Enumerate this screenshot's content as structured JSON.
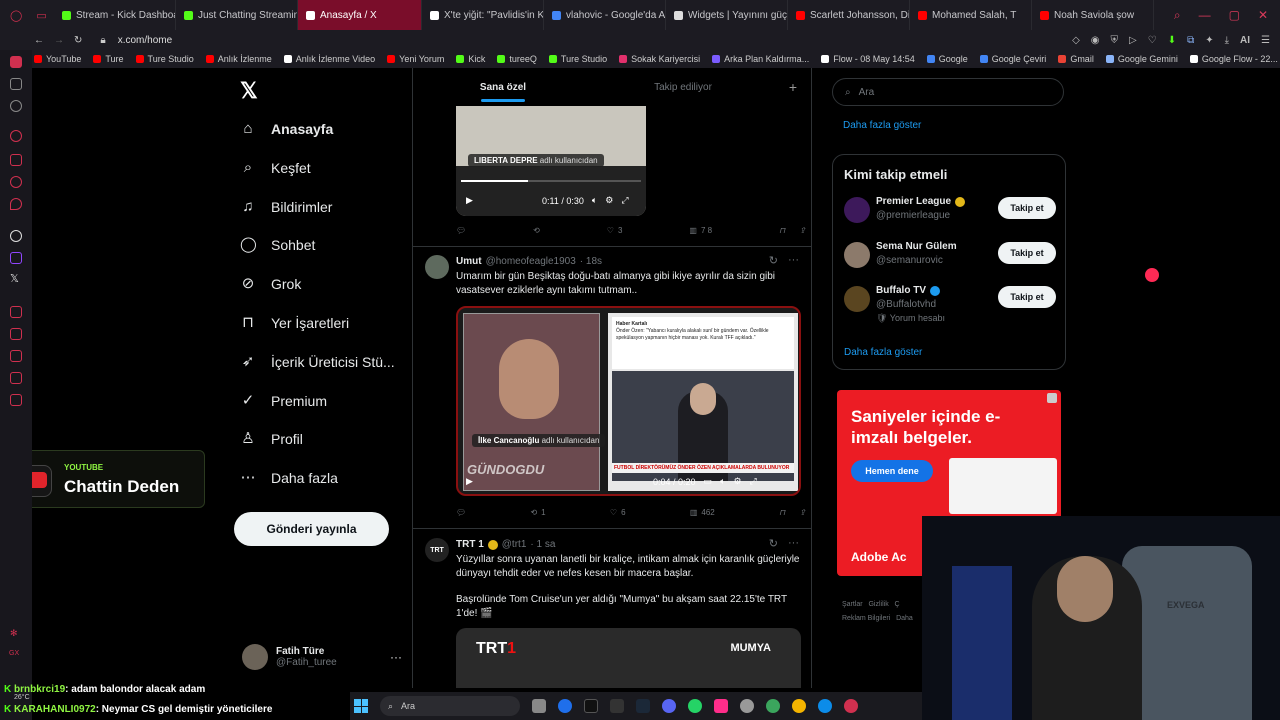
{
  "browser": {
    "tabs": [
      {
        "title": "Stream - Kick Dashboard",
        "color": "#53fc18",
        "active": false
      },
      {
        "title": "Just Chatting Streaming",
        "color": "#53fc18",
        "active": false
      },
      {
        "title": "Anasayfa / X",
        "color": "#ffffff",
        "active": true
      },
      {
        "title": "X'te yiğit: \"Pavlidis'in Ker",
        "color": "#ffffff",
        "active": false
      },
      {
        "title": "vlahovic - Google'da Ara",
        "color": "#4285f4",
        "active": false
      },
      {
        "title": "Widgets | Yayınını güçlen",
        "color": "#dddddd",
        "active": false
      },
      {
        "title": "Scarlett Johansson, Disn",
        "color": "#ff0000",
        "active": false
      },
      {
        "title": "Mohamed Salah, T",
        "color": "#ff0000",
        "active": false
      },
      {
        "title": "Noah Saviola şow",
        "color": "#ff0000",
        "active": false
      }
    ],
    "url": "x.com/home",
    "ai_label": "AI",
    "bookmarks": [
      {
        "label": "YouTube",
        "color": "#ff0000"
      },
      {
        "label": "Ture",
        "color": "#ff0000"
      },
      {
        "label": "Ture Studio",
        "color": "#ff0000"
      },
      {
        "label": "Anlık İzlenme",
        "color": "#ff0000"
      },
      {
        "label": "Anlık İzlenme Video",
        "color": "#ffffff"
      },
      {
        "label": "Yeni Yorum",
        "color": "#ff0000"
      },
      {
        "label": "Kick",
        "color": "#53fc18"
      },
      {
        "label": "tureeQ",
        "color": "#53fc18"
      },
      {
        "label": "Ture Studio",
        "color": "#53fc18"
      },
      {
        "label": "Sokak Kariyercisi",
        "color": "#e1306c"
      },
      {
        "label": "Arka Plan Kaldırma...",
        "color": "#7b5cff"
      },
      {
        "label": "Flow - 08 May 14:54",
        "color": "#ffffff"
      },
      {
        "label": "Google",
        "color": "#4285f4"
      },
      {
        "label": "Google Çeviri",
        "color": "#4285f4"
      },
      {
        "label": "Gmail",
        "color": "#ea4335"
      },
      {
        "label": "Google Gemini",
        "color": "#8ab4f8"
      },
      {
        "label": "Google Flow - 22...",
        "color": "#ffffff"
      }
    ]
  },
  "nav": {
    "logo": "𝕏",
    "items": [
      {
        "label": "Anasayfa",
        "icon": "⌂"
      },
      {
        "label": "Keşfet",
        "icon": "⌕"
      },
      {
        "label": "Bildirimler",
        "icon": "♫"
      },
      {
        "label": "Sohbet",
        "icon": "◯"
      },
      {
        "label": "Grok",
        "icon": "⊘"
      },
      {
        "label": "Yer İşaretleri",
        "icon": "⊓"
      },
      {
        "label": "İçerik Üreticisi Stü...",
        "icon": "➶"
      },
      {
        "label": "Premium",
        "icon": "✓"
      },
      {
        "label": "Profil",
        "icon": "♙"
      },
      {
        "label": "Daha fazla",
        "icon": "⋯"
      }
    ],
    "post_button": "Gönderi yayınla",
    "profile": {
      "name": "Fatih Türe",
      "handle": "@Fatih_turee",
      "more": "···"
    }
  },
  "overlay": {
    "youtube_tag": "YOUTUBE",
    "youtube_name": "Chattin Deden",
    "chat": [
      {
        "user": "brnbkrci19",
        "message": ": adam balondor alacak adam"
      },
      {
        "user": "KARAHANLI0972",
        "message": ": Neymar CS gel demiştir yöneticilere"
      }
    ],
    "weather": "26°C",
    "search": "Ara"
  },
  "timeline": {
    "tabs": [
      "Sana özel",
      "Takip ediliyor"
    ],
    "plus": "+",
    "post1": {
      "credit_user": "LIBERTA DEPRE",
      "credit_suffix": "adlı kullanıcıdan",
      "time": "0:11 / 0:30",
      "reply": "",
      "retweet": "",
      "likes": "3",
      "views": "7 8"
    },
    "post2": {
      "name": "Umut",
      "handle": "@homeofeagle1903",
      "time": "· 18s",
      "text": "Umarım bir gün Beşiktaş doğu-batı almanya gibi ikiye ayrılır da sizin gibi vasatsever eziklerle aynı takımı tutmam..",
      "credit_user": "İlke Cancanoğlu",
      "credit_suffix": "adlı kullanıcıdan",
      "video_time": "0:04 / 0:20",
      "overlay_word": "GÜNDOGDU",
      "card_header": "Haber Kartalı",
      "card_body": "Önder Özen: \"Yabancı kuralıyla alakalı sunî bir gündem var. Özellikle spekülasyon yapmanın hiçbir manası yok. Kuralı TFF açıkladı.\"",
      "banner": "FUTBOL DİREKTÖRÜMÜZ ÖNDER ÖZEN AÇIKLAMALARDA BULUNUYOR",
      "reply": "",
      "retweet": "1",
      "likes": "6",
      "views": "462"
    },
    "post3": {
      "name": "TRT 1",
      "handle": "@trt1",
      "time": "· 1 sa",
      "text1": "Yüzyıllar sonra uyanan lanetli bir kraliçe, intikam almak için karanlık güçleriyle dünyayı tehdit eder ve nefes kesen bir macera başlar.",
      "text2": "Başrolünde Tom Cruise'un yer aldığı \"Mumya\" bu akşam saat 22.15'te TRT 1'de! 🎬",
      "logo_trt": "TRT",
      "logo_1": "1",
      "mumya": "MUMYA"
    }
  },
  "sidebar": {
    "search_placeholder": "Ara",
    "show_more_1": "Daha fazla göster",
    "who_to_follow": "Kimi takip etmeli",
    "follow_label": "Takip et",
    "suggestions": [
      {
        "name": "Premier League",
        "handle": "@premierleague",
        "sub": "",
        "verified_color": "#e2b719",
        "avatar_color": "#3d195b"
      },
      {
        "name": "Sema Nur Gülem",
        "handle": "@semanurovic",
        "sub": "",
        "verified_color": "",
        "avatar_color": "#8c7a6b"
      },
      {
        "name": "Buffalo TV",
        "handle": "@Buffalotvhd",
        "sub": "🛡 Yorum hesabı",
        "verified_color": "#1d9bf0",
        "avatar_color": "#5a4520"
      }
    ],
    "show_more_2": "Daha fazla göster",
    "ad": {
      "title": "Saniyeler içinde e-imzalı belgeler.",
      "button": "Hemen dene",
      "brand": "Adobe Ac"
    },
    "footer": [
      "Şartlar",
      "Gizlilik",
      "Ç",
      "Reklam Bilgileri",
      "Daha"
    ]
  },
  "webcam": {
    "chair_brand": "EXVEGA"
  },
  "colors": {
    "accent": "#1d9bf0",
    "opera": "#d0304f",
    "kick": "#53fc18"
  }
}
